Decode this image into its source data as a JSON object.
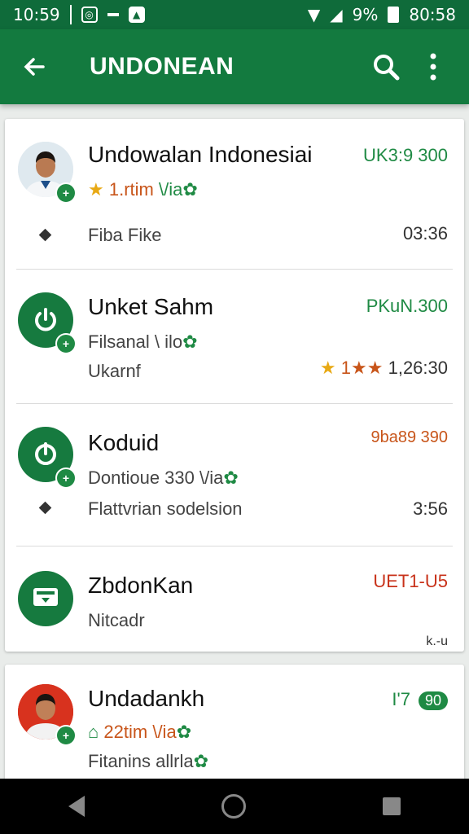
{
  "status_bar": {
    "time_left": "10:59",
    "time_right": "80:58",
    "percent": "9%"
  },
  "toolbar": {
    "title": "UNDONEAN"
  },
  "items": [
    {
      "name": "Undowalan Indonesiai",
      "amount": "UK3:9 300",
      "rating": "1.rtim",
      "via": "\\/ia",
      "meta": "Fiba Fike",
      "time": "03:36"
    },
    {
      "name": "Unket Sahm",
      "amount": "PKuN.300",
      "sub": "Filsanal \\ ilo",
      "meta": "Ukarnf",
      "rating": "1",
      "time": "1,26:30"
    },
    {
      "name": "Koduid",
      "amount": "9ba89 390",
      "sub": "Dontioue 330 \\/ia",
      "meta": "Flattvrian sodelsion",
      "time": "3:56"
    },
    {
      "name": "ZbdonKan",
      "amount": "UET1-U5",
      "meta": "Nitcadr",
      "time": "k.-u"
    },
    {
      "name": "Undadankh",
      "amount": "I'7",
      "amount_badge": "90",
      "sub": "22tim \\/ia",
      "meta": "Fitanins allrla"
    }
  ]
}
